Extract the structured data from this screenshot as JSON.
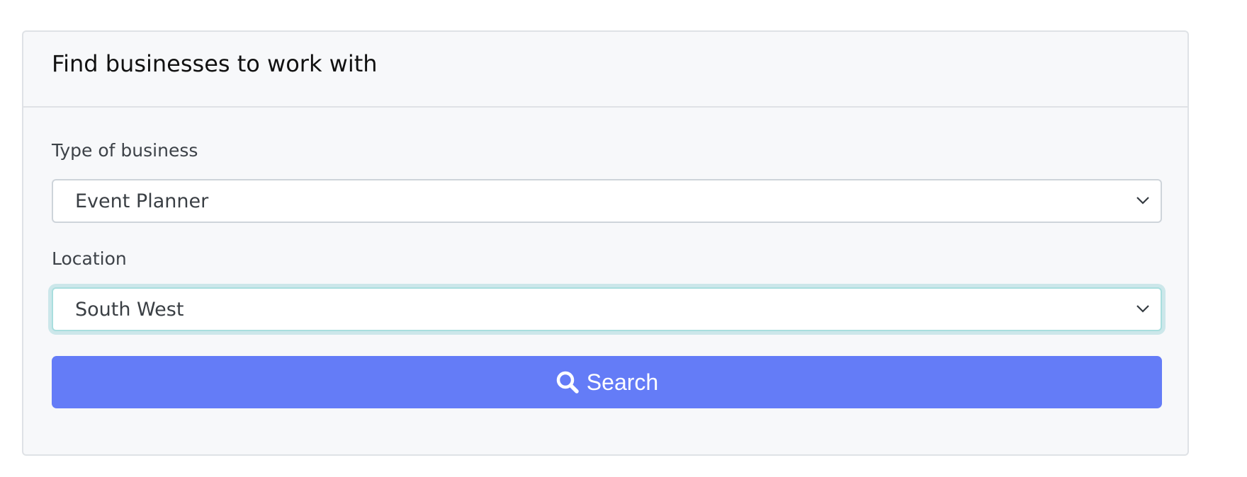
{
  "card": {
    "title": "Find businesses to work with"
  },
  "form": {
    "business_type": {
      "label": "Type of business",
      "selected": "Event Planner"
    },
    "location": {
      "label": "Location",
      "selected": "South West"
    },
    "search_button": {
      "label": "Search",
      "icon": "search-icon"
    }
  },
  "colors": {
    "primary": "#647cf7",
    "card_background": "#f7f8fa",
    "focus_ring": "#a9dede"
  }
}
